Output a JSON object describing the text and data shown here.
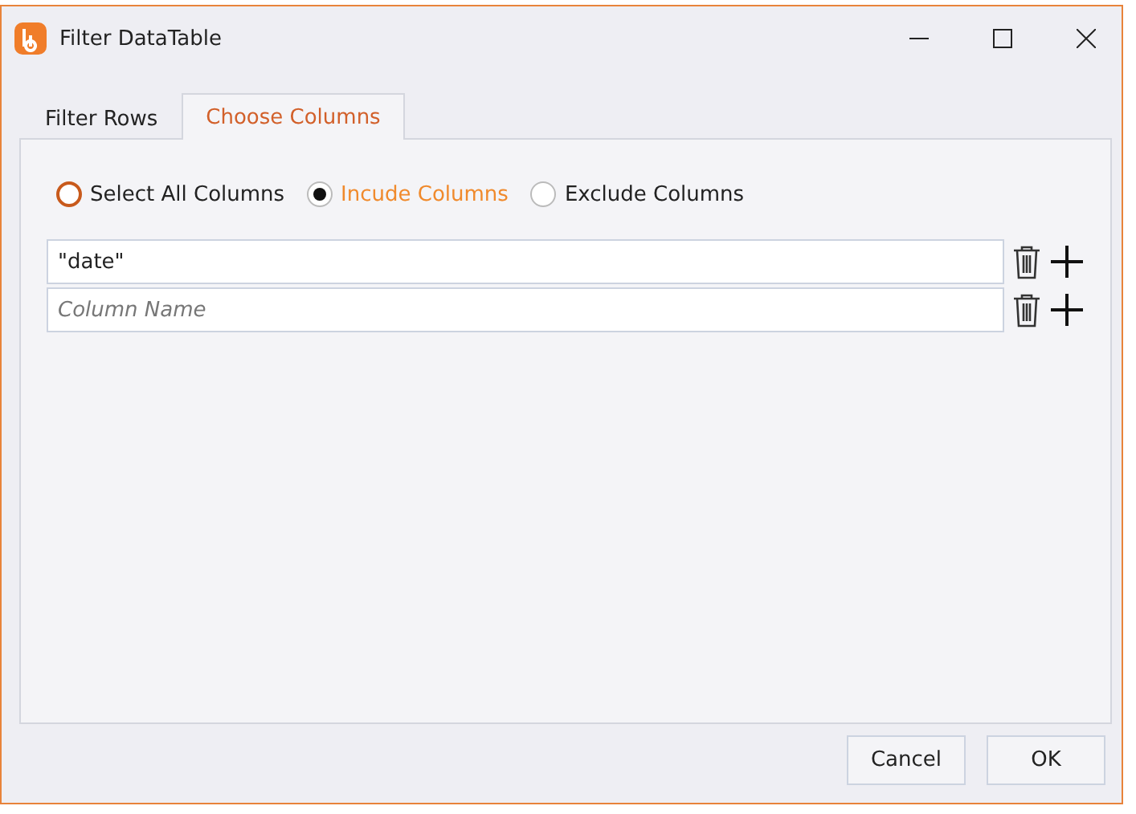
{
  "window": {
    "title": "Filter DataTable"
  },
  "tabs": [
    {
      "label": "Filter Rows",
      "selected": false
    },
    {
      "label": "Choose Columns",
      "selected": true
    }
  ],
  "mode_options": [
    {
      "label": "Select All Columns",
      "selected": false,
      "highlighted": true
    },
    {
      "label": "Incude Columns",
      "selected": true,
      "highlighted": false
    },
    {
      "label": "Exclude Columns",
      "selected": false,
      "highlighted": false
    }
  ],
  "columns": [
    {
      "value": "\"date\""
    },
    {
      "placeholder": "Column Name"
    }
  ],
  "buttons": [
    "Cancel",
    "OK"
  ]
}
